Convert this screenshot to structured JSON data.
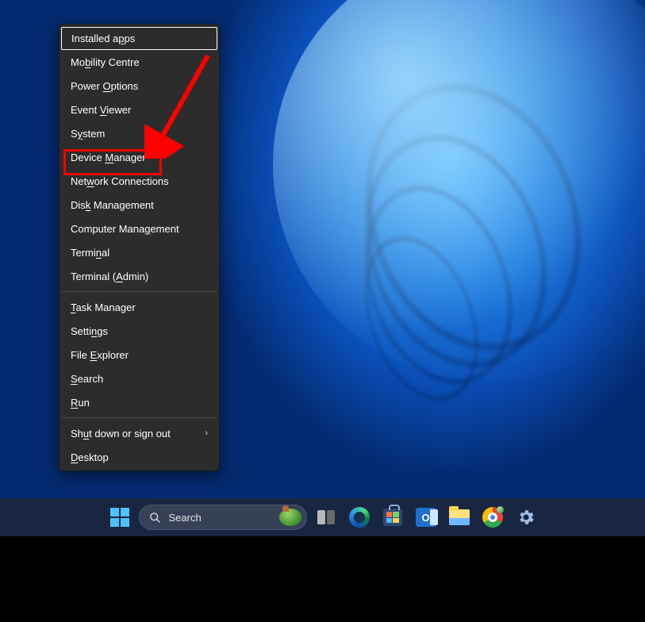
{
  "menu": {
    "groups": [
      {
        "items": [
          {
            "pre": "Installed a",
            "u": "p",
            "post": "ps",
            "selected": true
          },
          {
            "pre": "Mo",
            "u": "b",
            "post": "ility Centre"
          },
          {
            "pre": "Power ",
            "u": "O",
            "post": "ptions"
          },
          {
            "pre": "Event ",
            "u": "V",
            "post": "iewer"
          },
          {
            "pre": "S",
            "u": "y",
            "post": "stem"
          },
          {
            "pre": "Device ",
            "u": "M",
            "post": "anager",
            "highlighted": true
          },
          {
            "pre": "Net",
            "u": "w",
            "post": "ork Connections"
          },
          {
            "pre": "Dis",
            "u": "k",
            "post": " Management"
          },
          {
            "pre": "Computer Mana",
            "u": "g",
            "post": "ement"
          },
          {
            "pre": "Termi",
            "u": "n",
            "post": "al"
          },
          {
            "pre": "Terminal (",
            "u": "A",
            "post": "dmin)"
          }
        ]
      },
      {
        "items": [
          {
            "pre": "",
            "u": "T",
            "post": "ask Manager"
          },
          {
            "pre": "Setti",
            "u": "n",
            "post": "gs"
          },
          {
            "pre": "File ",
            "u": "E",
            "post": "xplorer"
          },
          {
            "pre": "",
            "u": "S",
            "post": "earch"
          },
          {
            "pre": "",
            "u": "R",
            "post": "un"
          }
        ]
      },
      {
        "items": [
          {
            "pre": "Sh",
            "u": "u",
            "post": "t down or sign out",
            "submenu": true
          },
          {
            "pre": "",
            "u": "D",
            "post": "esktop"
          }
        ]
      }
    ]
  },
  "taskbar": {
    "search_placeholder": "Search",
    "icons": {
      "start": "start-icon",
      "search": "search-icon",
      "taskview": "task-view-icon",
      "edge": "edge-icon",
      "store": "microsoft-store-icon",
      "outlook": "outlook-icon",
      "explorer": "file-explorer-icon",
      "chrome": "chrome-icon",
      "settings": "settings-icon"
    },
    "outlook_letter": "O"
  },
  "annotation": {
    "arrow_color": "#ff0000",
    "highlight_target": "Device Manager"
  }
}
